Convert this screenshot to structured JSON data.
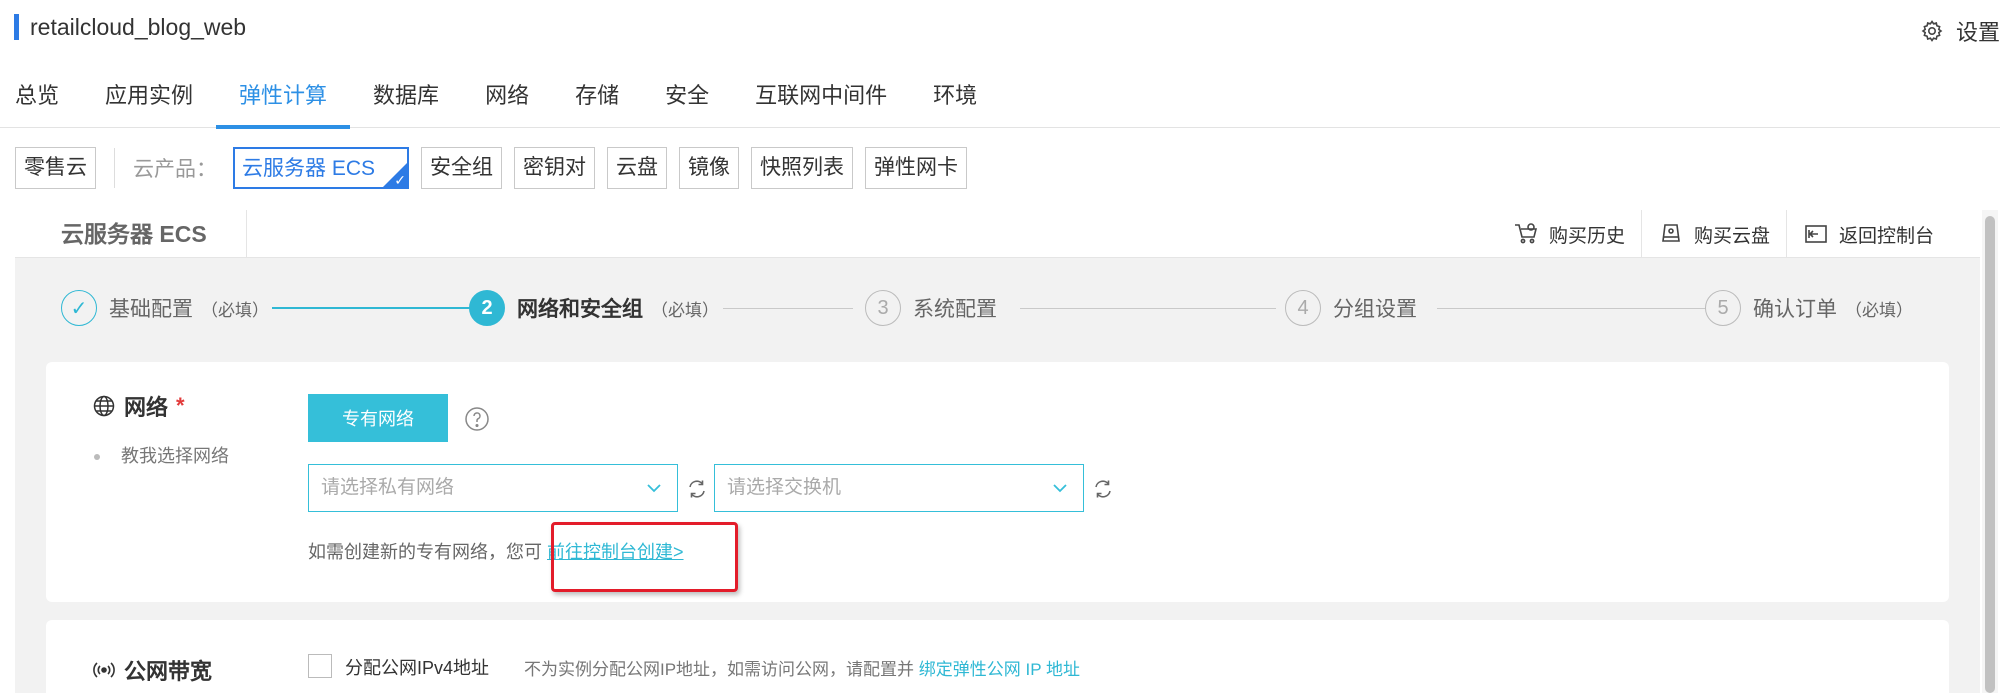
{
  "app": {
    "title": "retailcloud_blog_web",
    "settings_label": "设置"
  },
  "main_tabs": [
    {
      "label": "总览"
    },
    {
      "label": "应用实例"
    },
    {
      "label": "弹性计算",
      "active": true
    },
    {
      "label": "数据库"
    },
    {
      "label": "网络"
    },
    {
      "label": "存储"
    },
    {
      "label": "安全"
    },
    {
      "label": "互联网中间件"
    },
    {
      "label": "环境"
    }
  ],
  "subnav": {
    "home_chip": "零售云",
    "products_label": "云产品：",
    "products": [
      {
        "label": "云服务器 ECS",
        "selected": true
      },
      {
        "label": "安全组"
      },
      {
        "label": "密钥对"
      },
      {
        "label": "云盘"
      },
      {
        "label": "镜像"
      },
      {
        "label": "快照列表"
      },
      {
        "label": "弹性网卡"
      }
    ]
  },
  "panel": {
    "title": "云服务器 ECS",
    "actions": [
      {
        "label": "购买历史",
        "icon": "cart-icon"
      },
      {
        "label": "购买云盘",
        "icon": "disk-icon"
      },
      {
        "label": "返回控制台",
        "icon": "back-console-icon"
      }
    ]
  },
  "steps": [
    {
      "number": "✓",
      "label": "基础配置",
      "note": "（必填）",
      "state": "done"
    },
    {
      "number": "2",
      "label": "网络和安全组",
      "note": "（必填）",
      "state": "current"
    },
    {
      "number": "3",
      "label": "系统配置",
      "note": "",
      "state": "pending"
    },
    {
      "number": "4",
      "label": "分组设置",
      "note": "",
      "state": "pending"
    },
    {
      "number": "5",
      "label": "确认订单",
      "note": "（必填）",
      "state": "pending"
    }
  ],
  "network": {
    "title": "网络",
    "required_mark": "*",
    "hint": "教我选择网络",
    "vpc_button": "专有网络",
    "vpc_placeholder": "请选择私有网络",
    "switch_placeholder": "请选择交换机",
    "create_note": "如需创建新的专有网络，您可",
    "create_link": "前往控制台创建>"
  },
  "bandwidth": {
    "title": "公网带宽",
    "checkbox_label": "分配公网IPv4地址",
    "note": "不为实例分配公网IP地址，如需访问公网，请配置并",
    "note_link": "绑定弹性公网 IP 地址"
  },
  "colors": {
    "accent_blue": "#2d90e5",
    "teal": "#35bfd9",
    "highlight_red": "#e31c2a"
  }
}
